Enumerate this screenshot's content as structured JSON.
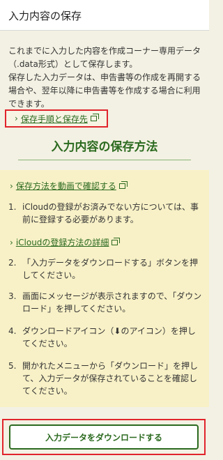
{
  "header": {
    "title": "入力内容の保存"
  },
  "intro": {
    "line1": "これまでに入力した内容を作成コーナー専用データ（.data形式）として保存します。",
    "line2": "保存した入力データは、申告書等の作成を再開する場合や、翌年以降に申告書等を作成する場合に利用できます。"
  },
  "links": {
    "save_procedure": "保存手順と保存先",
    "video": "保存方法を動画で確認する",
    "icloud": "iCloudの登録方法の詳細"
  },
  "section": {
    "title": "入力内容の保存方法"
  },
  "steps": [
    {
      "num": "1.",
      "text": "iCloudの登録がお済みでない方については、事前に登録する必要があります。"
    },
    {
      "num": "2.",
      "text": "「入力データをダウンロードする」ボタンを押してください。"
    },
    {
      "num": "3.",
      "text": "画面にメッセージが表示されますので、「ダウンロード」を押してください。"
    },
    {
      "num": "4.",
      "text": "ダウンロードアイコン（⬇のアイコン）を押してください。"
    },
    {
      "num": "5.",
      "text": "開かれたメニューから「ダウンロード」を押して、入力データが保存されていることを確認してください。"
    }
  ],
  "download_button": {
    "label": "入力データをダウンロードする"
  },
  "colors": {
    "accent": "#2b6a1f",
    "highlight": "#e0242b",
    "panel": "#f8f1c7"
  }
}
